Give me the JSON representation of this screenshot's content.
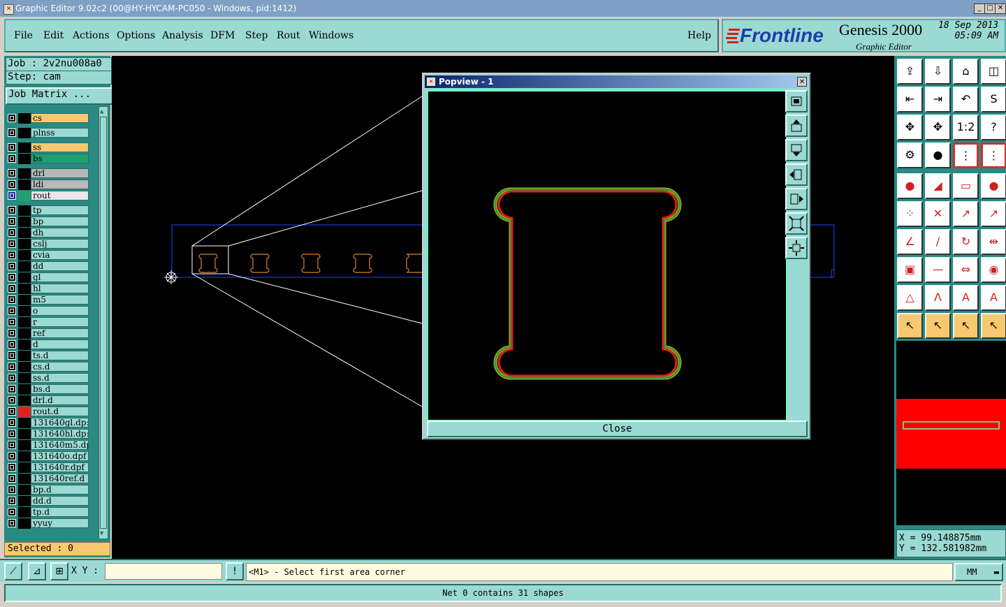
{
  "window": {
    "title": "Graphic Editor 9.02c2 (00@HY-HYCAM-PC050 - Windows, pid:1412)"
  },
  "menu": [
    "File",
    "Edit",
    "Actions",
    "Options",
    "Analysis",
    "DFM",
    "Step",
    "Rout",
    "Windows",
    "Help"
  ],
  "brand": {
    "logo": "Frontline",
    "product": "Genesis 2000",
    "module": "Graphic Editor",
    "date": "18 Sep 2013",
    "time": "05:09 AM"
  },
  "job": {
    "job_line": "Job : 2v2nu008a0",
    "step_line": "Step: cam",
    "matrix_button": "Job Matrix ..."
  },
  "layers": [
    {
      "name": "cs",
      "color": "#f8c870"
    },
    {
      "name": "plnss",
      "color": "#9bd9d3"
    },
    {
      "name": "ss",
      "color": "#f8c870"
    },
    {
      "name": "bs",
      "color": "#20a070"
    },
    {
      "name": "drl",
      "color": "#b8b8b8"
    },
    {
      "name": "ldi",
      "color": "#b8b8b8"
    },
    {
      "name": "rout",
      "color": "#e8e8e8",
      "active": true
    },
    {
      "name": "tp",
      "color": "#9bd9d3"
    },
    {
      "name": "bp",
      "color": "#9bd9d3"
    },
    {
      "name": "dh",
      "color": "#9bd9d3"
    },
    {
      "name": "cslj",
      "color": "#9bd9d3"
    },
    {
      "name": "cvia",
      "color": "#9bd9d3"
    },
    {
      "name": "dd",
      "color": "#9bd9d3"
    },
    {
      "name": "gl",
      "color": "#9bd9d3"
    },
    {
      "name": "hl",
      "color": "#9bd9d3"
    },
    {
      "name": "m5",
      "color": "#9bd9d3"
    },
    {
      "name": "o",
      "color": "#9bd9d3"
    },
    {
      "name": "r",
      "color": "#9bd9d3"
    },
    {
      "name": "ref",
      "color": "#9bd9d3"
    },
    {
      "name": "d",
      "color": "#9bd9d3"
    },
    {
      "name": "ts.d",
      "color": "#9bd9d3"
    },
    {
      "name": "cs.d",
      "color": "#9bd9d3"
    },
    {
      "name": "ss.d",
      "color": "#9bd9d3"
    },
    {
      "name": "bs.d",
      "color": "#9bd9d3"
    },
    {
      "name": "drl.d",
      "color": "#9bd9d3"
    },
    {
      "name": "rout.d",
      "color": "#9bd9d3",
      "marker": "#e02020"
    },
    {
      "name": "131640gl.dp:",
      "color": "#9bd9d3"
    },
    {
      "name": "131640hl.dp:",
      "color": "#9bd9d3"
    },
    {
      "name": "131640m5.dp:",
      "color": "#9bd9d3"
    },
    {
      "name": "131640o.dpf",
      "color": "#9bd9d3"
    },
    {
      "name": "131640r.dpf",
      "color": "#9bd9d3"
    },
    {
      "name": "131640ref.d",
      "color": "#9bd9d3"
    },
    {
      "name": "bp.d",
      "color": "#9bd9d3"
    },
    {
      "name": "dd.d",
      "color": "#9bd9d3"
    },
    {
      "name": "tp.d",
      "color": "#9bd9d3"
    },
    {
      "name": "yyuy",
      "color": "#9bd9d3"
    }
  ],
  "selected": "Selected : 0",
  "popup": {
    "title": "Popview - 1",
    "close_label": "Close"
  },
  "coords": {
    "x": "X = 99.148875mm",
    "y": "Y = 132.581982mm"
  },
  "input": {
    "xy_label": "X Y :",
    "prompt": "<M1> - Select first area corner",
    "units": "MM"
  },
  "status": "Net 0 contains 31 shapes",
  "colors": {
    "panel": "#9bd9d3",
    "panel_dark": "#2a8a82",
    "outline_red": "#e02020",
    "outline_green": "#3a9a30",
    "outline_yellow": "#c8b020",
    "canvas": "#000000",
    "overview_red": "#ff0000"
  }
}
